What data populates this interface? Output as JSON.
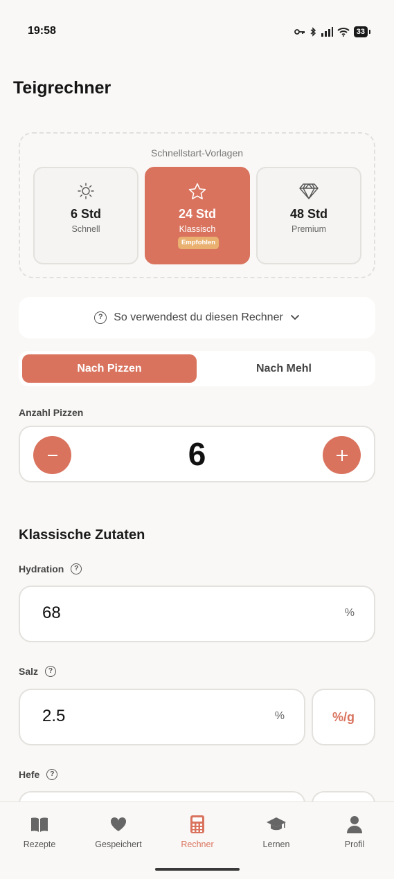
{
  "status": {
    "time": "19:58",
    "battery": "33"
  },
  "page": {
    "title": "Teigrechner"
  },
  "presets": {
    "title": "Schnellstart-Vorlagen",
    "items": [
      {
        "time": "6 Std",
        "name": "Schnell",
        "icon": "sun-icon"
      },
      {
        "time": "24 Std",
        "name": "Klassisch",
        "icon": "star-icon",
        "badge": "Empfohlen"
      },
      {
        "time": "48 Std",
        "name": "Premium",
        "icon": "diamond-icon"
      }
    ]
  },
  "howto": {
    "label": "So verwendest du diesen Rechner"
  },
  "mode": {
    "by_pizzas": "Nach Pizzen",
    "by_flour": "Nach Mehl",
    "selected": "Nach Pizzen"
  },
  "pizza_count": {
    "label": "Anzahl Pizzen",
    "value": "6"
  },
  "ingredients": {
    "title": "Klassische Zutaten",
    "hydration": {
      "label": "Hydration",
      "value": "68",
      "unit": "%"
    },
    "salt": {
      "label": "Salz",
      "value": "2.5",
      "unit": "%",
      "toggle": "%/g"
    },
    "yeast": {
      "label": "Hefe"
    }
  },
  "nav": {
    "items": [
      {
        "label": "Rezepte",
        "icon": "book-icon"
      },
      {
        "label": "Gespeichert",
        "icon": "heart-icon"
      },
      {
        "label": "Rechner",
        "icon": "calculator-icon",
        "active": true
      },
      {
        "label": "Lernen",
        "icon": "graduation-cap-icon"
      },
      {
        "label": "Profil",
        "icon": "person-icon"
      }
    ]
  },
  "colors": {
    "accent": "#d9735e",
    "badge": "#e9b070",
    "background": "#f9f8f6"
  }
}
